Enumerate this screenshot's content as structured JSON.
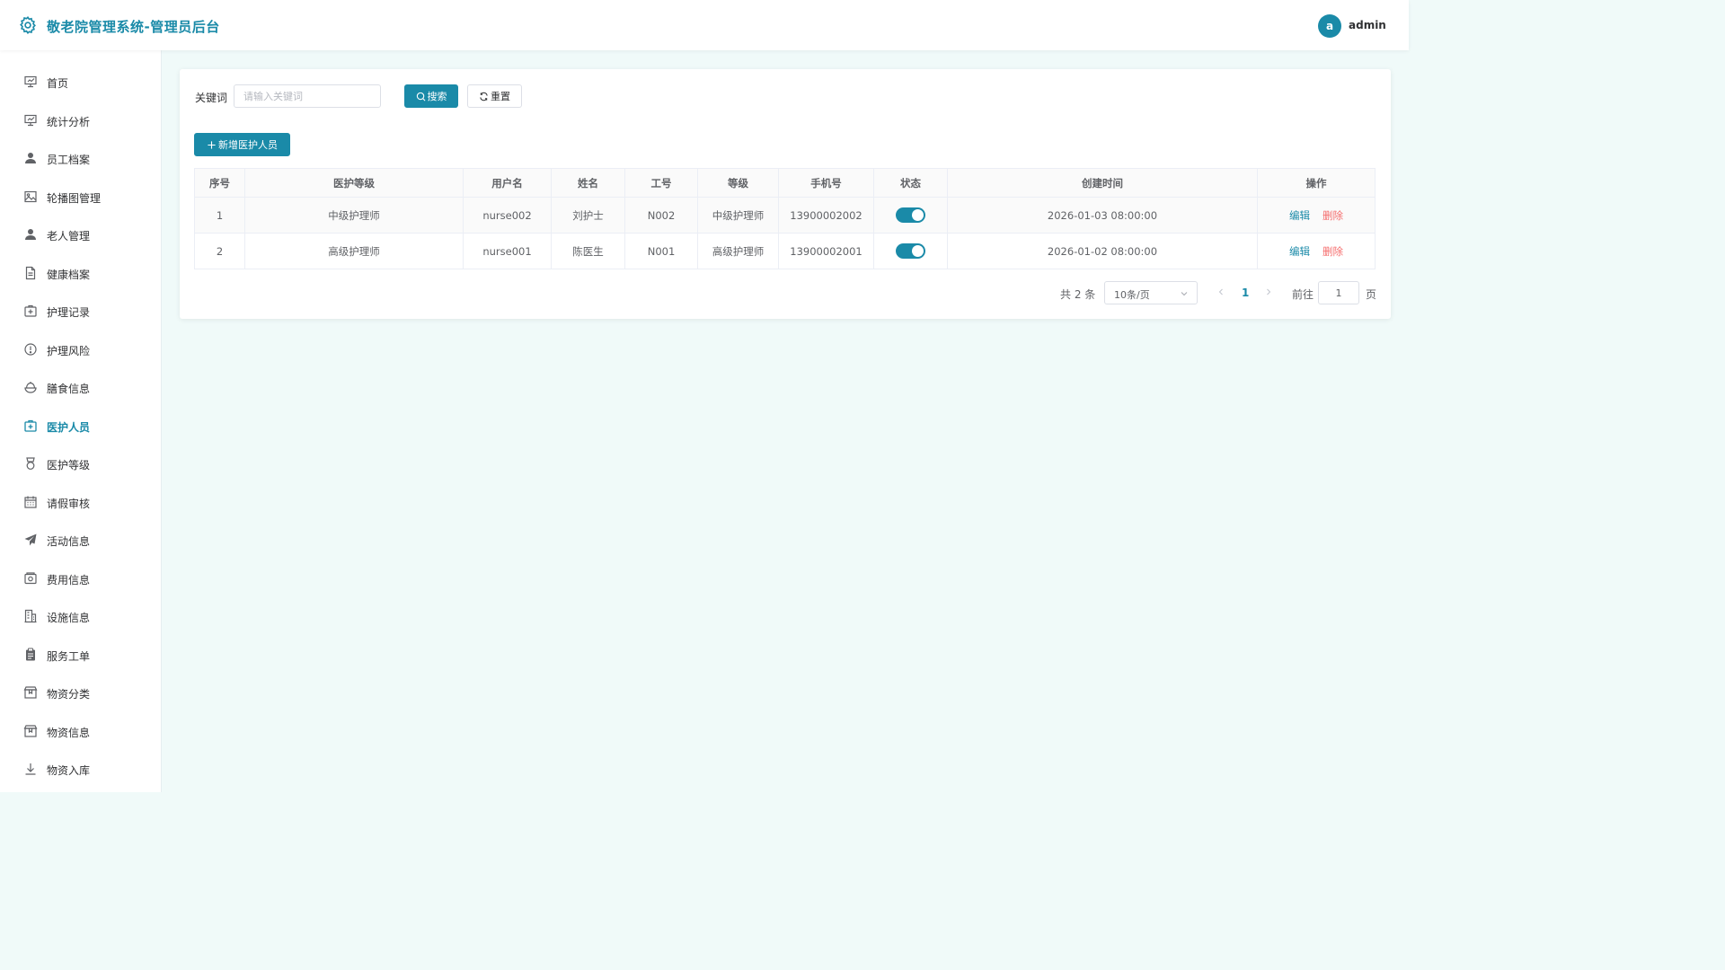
{
  "header": {
    "title": "敬老院管理系统-管理员后台",
    "avatar_letter": "a",
    "username": "admin"
  },
  "sidebar": {
    "items": [
      {
        "label": "首页",
        "icon": "presentation-icon"
      },
      {
        "label": "统计分析",
        "icon": "presentation-icon"
      },
      {
        "label": "员工档案",
        "icon": "user-icon"
      },
      {
        "label": "轮播图管理",
        "icon": "picture-icon"
      },
      {
        "label": "老人管理",
        "icon": "user-icon"
      },
      {
        "label": "健康档案",
        "icon": "document-icon"
      },
      {
        "label": "护理记录",
        "icon": "first-aid-kit-icon"
      },
      {
        "label": "护理风险",
        "icon": "warning-icon"
      },
      {
        "label": "膳食信息",
        "icon": "food-icon"
      },
      {
        "label": "医护人员",
        "icon": "first-aid-kit-icon",
        "active": true
      },
      {
        "label": "医护等级",
        "icon": "medal-icon"
      },
      {
        "label": "请假审核",
        "icon": "calendar-icon"
      },
      {
        "label": "活动信息",
        "icon": "paper-plane-icon"
      },
      {
        "label": "费用信息",
        "icon": "wallet-icon"
      },
      {
        "label": "设施信息",
        "icon": "office-building-icon"
      },
      {
        "label": "服务工单",
        "icon": "clipboard-icon"
      },
      {
        "label": "物资分类",
        "icon": "box-icon"
      },
      {
        "label": "物资信息",
        "icon": "box-icon"
      },
      {
        "label": "物资入库",
        "icon": "download-icon"
      }
    ]
  },
  "search": {
    "label": "关键词",
    "placeholder": "请输入关键词",
    "value": "",
    "search_label": "搜索",
    "reset_label": "重置"
  },
  "toolbar": {
    "add_label": "新增医护人员"
  },
  "table": {
    "columns": [
      "序号",
      "医护等级",
      "用户名",
      "姓名",
      "工号",
      "等级",
      "手机号",
      "状态",
      "创建时间",
      "操作"
    ],
    "rows": [
      {
        "index": "1",
        "care_level": "中级护理师",
        "username": "nurse002",
        "name": "刘护士",
        "job_no": "N002",
        "level": "中级护理师",
        "phone": "13900002002",
        "status_on": true,
        "created": "2026-01-03 08:00:00",
        "edit": "编辑",
        "delete": "删除"
      },
      {
        "index": "2",
        "care_level": "高级护理师",
        "username": "nurse001",
        "name": "陈医生",
        "job_no": "N001",
        "level": "高级护理师",
        "phone": "13900002001",
        "status_on": true,
        "created": "2026-01-02 08:00:00",
        "edit": "编辑",
        "delete": "删除"
      }
    ]
  },
  "pagination": {
    "total": "共 2 条",
    "page_size": "10条/页",
    "current_page": "1",
    "goto_label": "前往",
    "goto_value": "1",
    "page_suffix": "页"
  },
  "colors": {
    "primary": "#1a8aa8",
    "danger": "#f56c6c",
    "background": "#f0faf9"
  }
}
